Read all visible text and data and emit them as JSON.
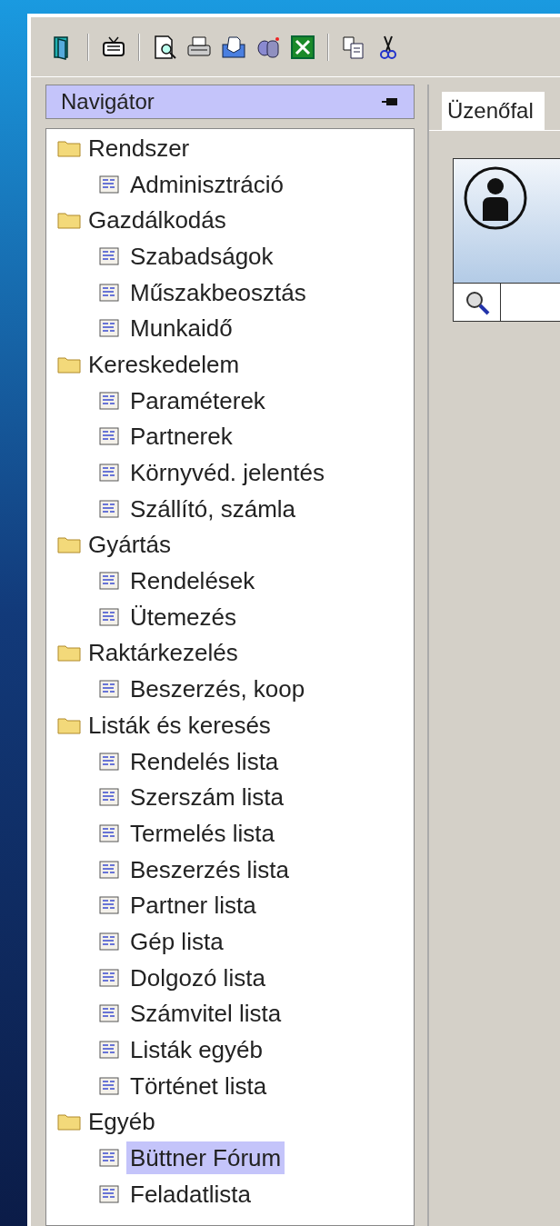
{
  "navigator": {
    "title": "Navigátor"
  },
  "tree": [
    {
      "label": "Rendszer",
      "children": [
        {
          "label": "Adminisztráció",
          "selected": false
        }
      ]
    },
    {
      "label": "Gazdálkodás",
      "children": [
        {
          "label": "Szabadságok",
          "selected": false
        },
        {
          "label": "Műszakbeosztás",
          "selected": false
        },
        {
          "label": "Munkaidő",
          "selected": false
        }
      ]
    },
    {
      "label": "Kereskedelem",
      "children": [
        {
          "label": "Paraméterek",
          "selected": false
        },
        {
          "label": "Partnerek",
          "selected": false
        },
        {
          "label": "Környvéd. jelentés",
          "selected": false
        },
        {
          "label": "Szállító, számla",
          "selected": false
        }
      ]
    },
    {
      "label": "Gyártás",
      "children": [
        {
          "label": "Rendelések",
          "selected": false
        },
        {
          "label": "Ütemezés",
          "selected": false
        }
      ]
    },
    {
      "label": "Raktárkezelés",
      "children": [
        {
          "label": "Beszerzés, koop",
          "selected": false
        }
      ]
    },
    {
      "label": "Listák és keresés",
      "children": [
        {
          "label": "Rendelés lista",
          "selected": false
        },
        {
          "label": "Szerszám lista",
          "selected": false
        },
        {
          "label": "Termelés lista",
          "selected": false
        },
        {
          "label": "Beszerzés lista",
          "selected": false
        },
        {
          "label": "Partner lista",
          "selected": false
        },
        {
          "label": "Gép lista",
          "selected": false
        },
        {
          "label": "Dolgozó lista",
          "selected": false
        },
        {
          "label": "Számvitel lista",
          "selected": false
        },
        {
          "label": "Listák egyéb",
          "selected": false
        },
        {
          "label": "Történet lista",
          "selected": false
        }
      ]
    },
    {
      "label": "Egyéb",
      "children": [
        {
          "label": "Büttner Fórum",
          "selected": true
        },
        {
          "label": "Feladatlista",
          "selected": false
        }
      ]
    }
  ],
  "tabs": [
    {
      "label": "Üzenőfal",
      "selected": true
    }
  ]
}
